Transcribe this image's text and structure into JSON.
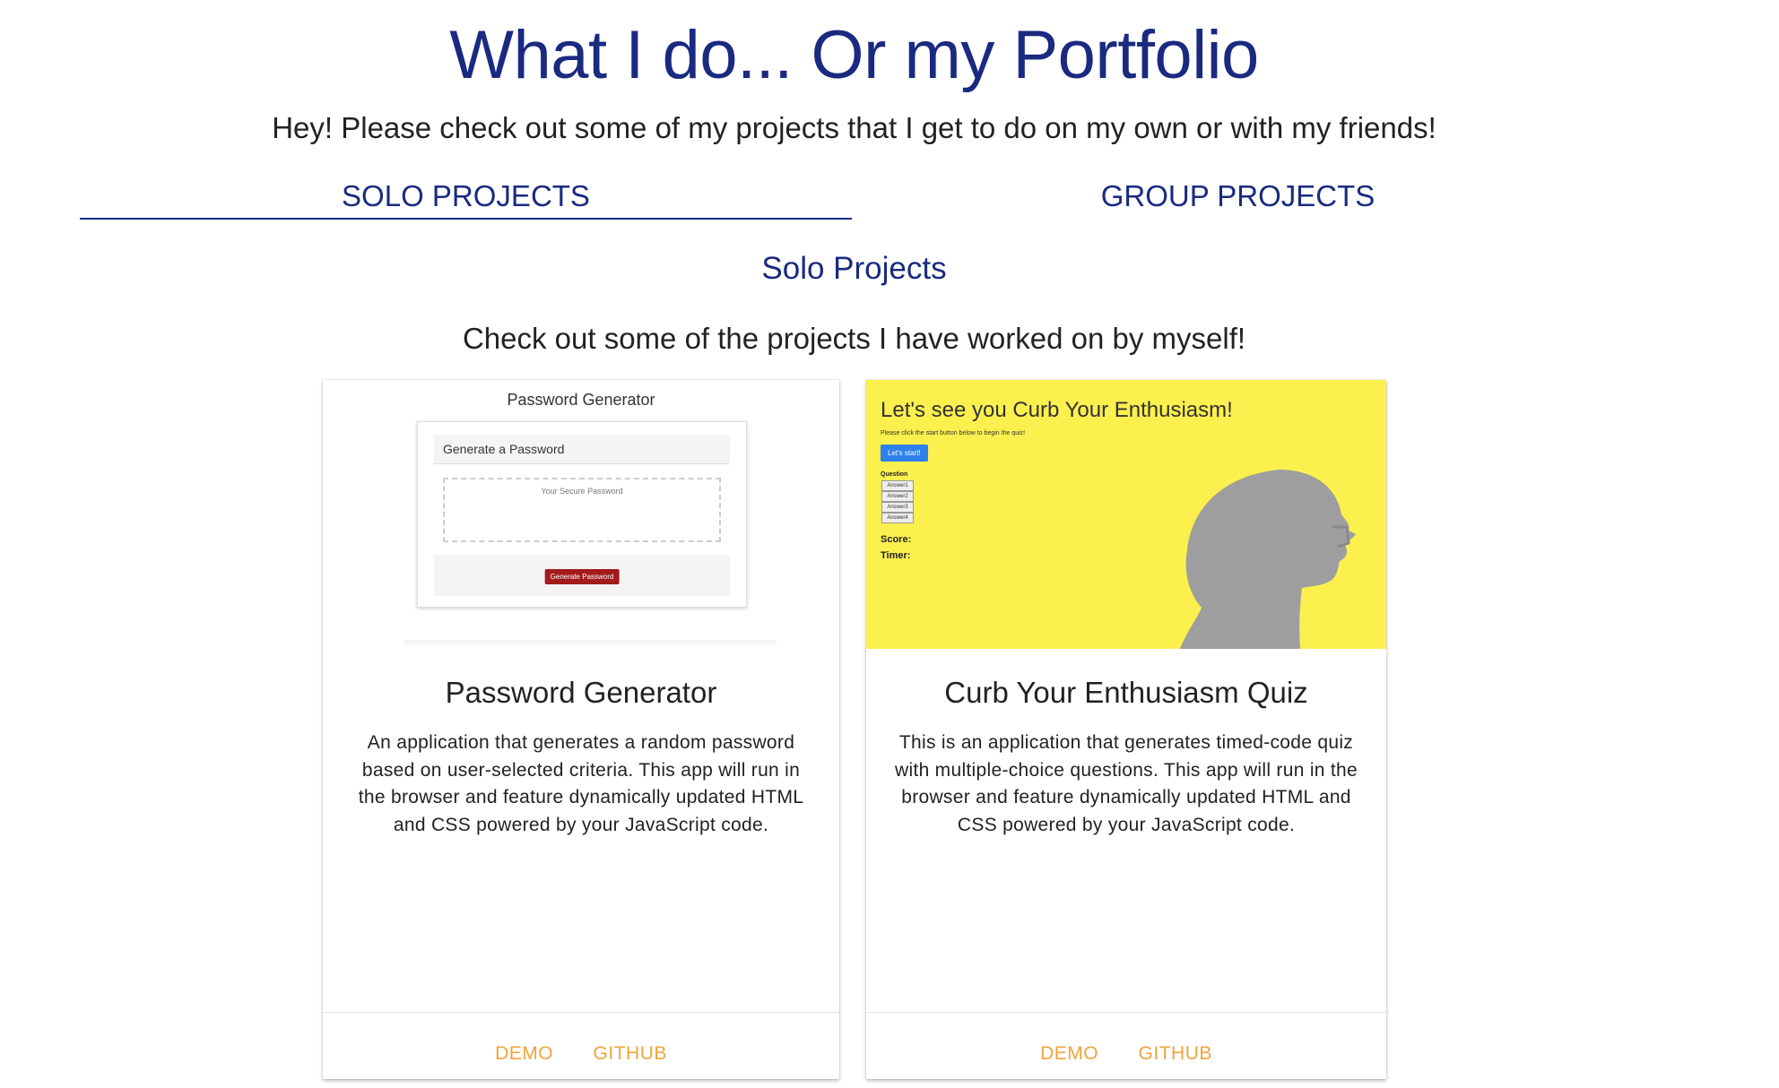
{
  "header": {
    "title": "What I do... Or my Portfolio",
    "subtitle": "Hey! Please check out some of my projects that I get to do on my own or with my friends!"
  },
  "tabs": [
    {
      "label": "SOLO PROJECTS",
      "active": true
    },
    {
      "label": "GROUP PROJECTS",
      "active": false
    }
  ],
  "section": {
    "title": "Solo Projects",
    "description": "Check out some of the projects I have worked on by myself!"
  },
  "cards": [
    {
      "title": "Password Generator",
      "description": "An application that generates a random password based on user-selected criteria. This app will run in the browser and feature dynamically updated HTML and CSS powered by your JavaScript code.",
      "actions": {
        "demo": "DEMO",
        "github": "GITHUB"
      },
      "thumbnail": {
        "heading": "Password Generator",
        "card_header": "Generate a Password",
        "placeholder": "Your Secure Password",
        "button": "Generate Password"
      }
    },
    {
      "title": "Curb Your Enthusiasm Quiz",
      "description": "This is an application that generates timed-code quiz with multiple-choice questions. This app will run in the browser and feature dynamically updated HTML and CSS powered by your JavaScript code.",
      "actions": {
        "demo": "DEMO",
        "github": "GITHUB"
      },
      "thumbnail": {
        "heading": "Let's see you Curb Your Enthusiasm!",
        "instructions": "Please click the start button below to begin the quiz!",
        "button": "Let's start!",
        "question": "Question",
        "answers": [
          "Answer1",
          "Answer2",
          "Answer3",
          "Answer4"
        ],
        "score_label": "Score:",
        "timer_label": "Timer:"
      }
    }
  ],
  "colors": {
    "primary": "#1a2a80",
    "accent": "#f2a33a",
    "quiz_background": "#fcf04e",
    "generate_button": "#a31b1b",
    "start_button": "#2f80ed"
  }
}
